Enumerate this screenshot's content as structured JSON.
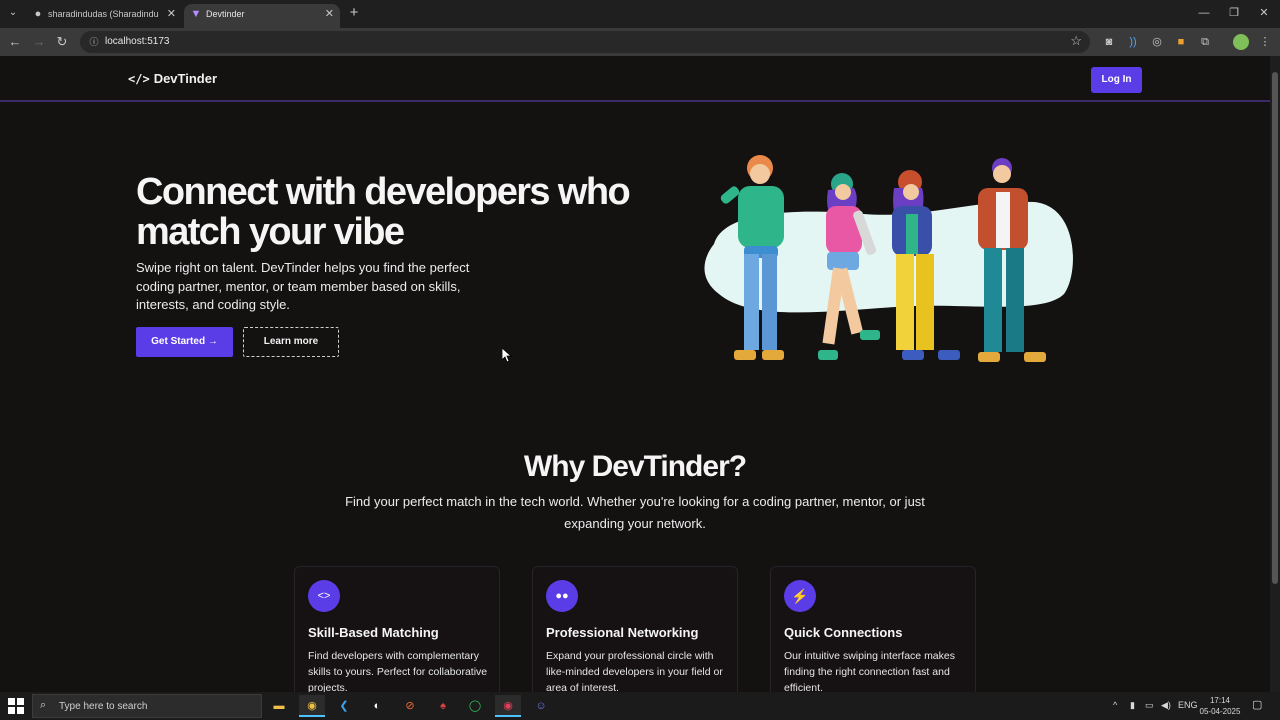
{
  "browser": {
    "tabs": [
      {
        "title": "sharadindudas (Sharadindu Das)",
        "favicon": "github-icon"
      },
      {
        "title": "Devtinder",
        "favicon": "vite-icon"
      }
    ],
    "url": "localhost:5173"
  },
  "nav": {
    "logo_text": "DevTinder",
    "login_label": "Log In"
  },
  "hero": {
    "title": "Connect with developers who match your vibe",
    "subtitle": "Swipe right on talent. DevTinder helps you find the perfect coding partner, mentor, or team member based on skills, interests, and coding style.",
    "cta_primary": "Get Started →",
    "cta_secondary": "Learn more"
  },
  "why": {
    "title": "Why DevTinder?",
    "subtitle": "Find your perfect match in the tech world. Whether you're looking for a coding partner, mentor, or just expanding your network."
  },
  "features": [
    {
      "icon": "code-icon",
      "title": "Skill-Based Matching",
      "description": "Find developers with complementary skills to yours. Perfect for collaborative projects."
    },
    {
      "icon": "users-icon",
      "title": "Professional Networking",
      "description": "Expand your professional circle with like-minded developers in your field or area of interest."
    },
    {
      "icon": "lightning-icon",
      "title": "Quick Connections",
      "description": "Our intuitive swiping interface makes finding the right connection fast and efficient."
    }
  ],
  "taskbar": {
    "search_placeholder": "Type here to search",
    "language": "ENG",
    "time": "17:14",
    "date": "05-04-2025"
  },
  "colors": {
    "accent": "#5b3de8",
    "background": "#141111"
  }
}
